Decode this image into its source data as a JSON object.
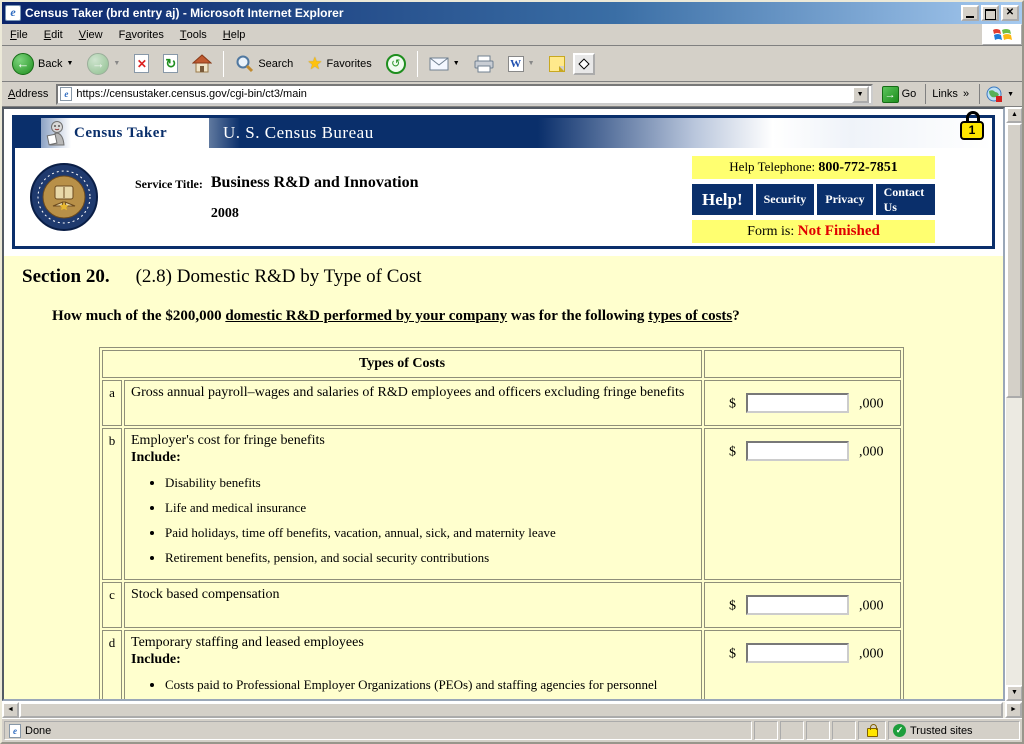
{
  "window": {
    "title": "Census Taker (brd entry aj) - Microsoft Internet Explorer"
  },
  "menu": {
    "items": [
      {
        "label": "File",
        "underline": 0
      },
      {
        "label": "Edit",
        "underline": 0
      },
      {
        "label": "View",
        "underline": 0
      },
      {
        "label": "Favorites",
        "underline": 1
      },
      {
        "label": "Tools",
        "underline": 0
      },
      {
        "label": "Help",
        "underline": 0
      }
    ]
  },
  "toolbar": {
    "back_label": "Back",
    "search_label": "Search",
    "favorites_label": "Favorites"
  },
  "address": {
    "label": "Address",
    "label_underline": 0,
    "url": "https://censustaker.census.gov/cgi-bin/ct3/main",
    "go_label": "Go",
    "links_label": "Links",
    "links_chevron": "»"
  },
  "header": {
    "brand": "Census Taker",
    "bureau": "U. S. Census Bureau",
    "service_title_label": "Service Title:",
    "service_title": "Business R&D and Innovation",
    "service_year": "2008",
    "help_phone_label": "Help Telephone: ",
    "help_phone_number": "800-772-7851",
    "buttons": [
      {
        "label": "Help!",
        "big": true
      },
      {
        "label": "Security",
        "big": false
      },
      {
        "label": "Privacy",
        "big": false
      },
      {
        "label": "Contact Us",
        "big": false
      }
    ],
    "form_status_label": "Form is: ",
    "form_status_value": "Not Finished",
    "lock_digit": "1"
  },
  "section": {
    "number": "Section 20.",
    "title": "(2.8) Domestic R&D by Type of Cost",
    "question_prefix": "How much of the $200,000 ",
    "question_underline1": "domestic R&D performed by your company",
    "question_middle": " was for the following ",
    "question_underline2": "types of costs",
    "question_suffix": "?"
  },
  "table": {
    "header": "Types of Costs",
    "dollar": "$",
    "thousand": ",000",
    "rows": [
      {
        "letter": "a",
        "rowclass": "row-a",
        "text": "Gross annual payroll–wages and salaries of R&D employees and officers excluding fringe benefits",
        "include_label": "",
        "bullets": []
      },
      {
        "letter": "b",
        "rowclass": "row-b",
        "text": "Employer's cost for fringe benefits",
        "include_label": "Include:",
        "bullets": [
          "Disability benefits",
          "Life and medical insurance",
          "Paid holidays, time off benefits, vacation, annual, sick, and maternity leave",
          "Retirement benefits, pension, and social security contributions"
        ]
      },
      {
        "letter": "c",
        "rowclass": "row-c",
        "text": "Stock based compensation",
        "include_label": "",
        "bullets": []
      },
      {
        "letter": "d",
        "rowclass": "row-d",
        "text": "Temporary staffing and leased employees",
        "include_label": "Include:",
        "bullets": [
          "Costs paid to Professional Employer Organizations (PEOs) and staffing agencies for personnel"
        ]
      }
    ]
  },
  "statusbar": {
    "status": "Done",
    "zone": "Trusted sites"
  },
  "icons": {
    "favorites_star": "★",
    "back_arrow": "←",
    "forward_arrow": "→",
    "stop_glyph": "✕",
    "refresh_glyph": "↻",
    "history_glyph": "↺",
    "check_glyph": "✓"
  },
  "colors": {
    "navy": "#0A2F6B",
    "page_yellow": "#FFFFCE",
    "highlight_yellow": "#FFFF70",
    "status_red": "#E00000"
  }
}
